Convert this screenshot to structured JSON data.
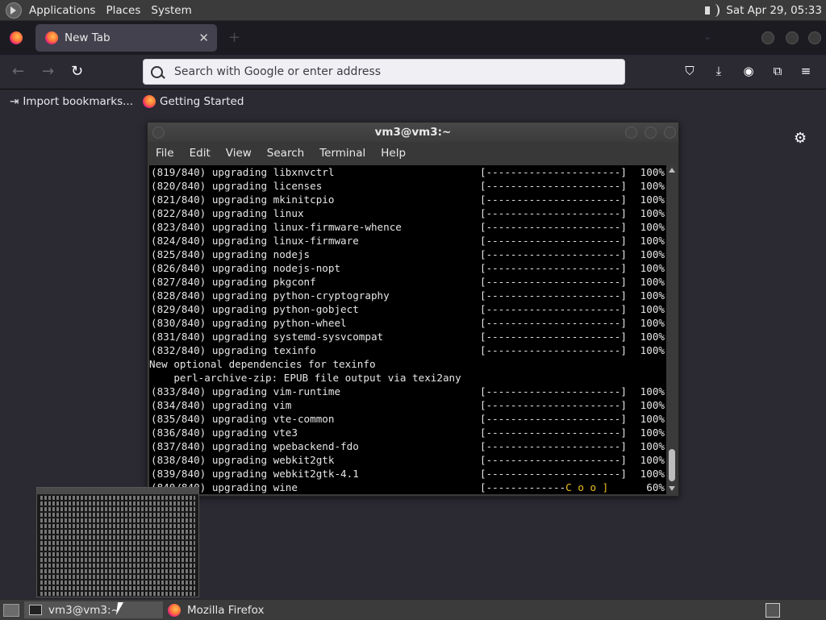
{
  "top_panel": {
    "menus": [
      "Applications",
      "Places",
      "System"
    ],
    "clock": "Sat Apr 29, 05:33"
  },
  "firefox": {
    "tab": {
      "title": "New Tab"
    },
    "urlbar": {
      "placeholder": "Search with Google or enter address"
    },
    "bookmarks": [
      "Import bookmarks...",
      "Getting Started"
    ]
  },
  "terminal": {
    "title": "vm3@vm3:~",
    "menu": [
      "File",
      "Edit",
      "View",
      "Search",
      "Terminal",
      "Help"
    ],
    "lines": [
      {
        "lead": "(819/840) upgrading libxnvctrl",
        "bar": "[----------------------]",
        "pct": "100%"
      },
      {
        "lead": "(820/840) upgrading licenses",
        "bar": "[----------------------]",
        "pct": "100%"
      },
      {
        "lead": "(821/840) upgrading mkinitcpio",
        "bar": "[----------------------]",
        "pct": "100%"
      },
      {
        "lead": "(822/840) upgrading linux",
        "bar": "[----------------------]",
        "pct": "100%"
      },
      {
        "lead": "(823/840) upgrading linux-firmware-whence",
        "bar": "[----------------------]",
        "pct": "100%"
      },
      {
        "lead": "(824/840) upgrading linux-firmware",
        "bar": "[----------------------]",
        "pct": "100%"
      },
      {
        "lead": "(825/840) upgrading nodejs",
        "bar": "[----------------------]",
        "pct": "100%"
      },
      {
        "lead": "(826/840) upgrading nodejs-nopt",
        "bar": "[----------------------]",
        "pct": "100%"
      },
      {
        "lead": "(827/840) upgrading pkgconf",
        "bar": "[----------------------]",
        "pct": "100%"
      },
      {
        "lead": "(828/840) upgrading python-cryptography",
        "bar": "[----------------------]",
        "pct": "100%"
      },
      {
        "lead": "(829/840) upgrading python-gobject",
        "bar": "[----------------------]",
        "pct": "100%"
      },
      {
        "lead": "(830/840) upgrading python-wheel",
        "bar": "[----------------------]",
        "pct": "100%"
      },
      {
        "lead": "(831/840) upgrading systemd-sysvcompat",
        "bar": "[----------------------]",
        "pct": "100%"
      },
      {
        "lead": "(832/840) upgrading texinfo",
        "bar": "[----------------------]",
        "pct": "100%"
      },
      {
        "lead": "New optional dependencies for texinfo",
        "bar": "",
        "pct": "",
        "plain": true
      },
      {
        "lead": "    perl-archive-zip: EPUB file output via texi2any",
        "bar": "",
        "pct": "",
        "plain": true
      },
      {
        "lead": "(833/840) upgrading vim-runtime",
        "bar": "[----------------------]",
        "pct": "100%"
      },
      {
        "lead": "(834/840) upgrading vim",
        "bar": "[----------------------]",
        "pct": "100%"
      },
      {
        "lead": "(835/840) upgrading vte-common",
        "bar": "[----------------------]",
        "pct": "100%"
      },
      {
        "lead": "(836/840) upgrading vte3",
        "bar": "[----------------------]",
        "pct": "100%"
      },
      {
        "lead": "(837/840) upgrading wpebackend-fdo",
        "bar": "[----------------------]",
        "pct": "100%"
      },
      {
        "lead": "(838/840) upgrading webkit2gtk",
        "bar": "[----------------------]",
        "pct": "100%"
      },
      {
        "lead": "(839/840) upgrading webkit2gtk-4.1",
        "bar": "[----------------------]",
        "pct": "100%"
      },
      {
        "lead": "(840/840) upgrading wine",
        "bar": "[-------------",
        "pac": "C o o ]",
        "pct": "60%"
      }
    ]
  },
  "taskbar": {
    "tasks": [
      "vm3@vm3:~",
      "Mozilla Firefox"
    ]
  }
}
